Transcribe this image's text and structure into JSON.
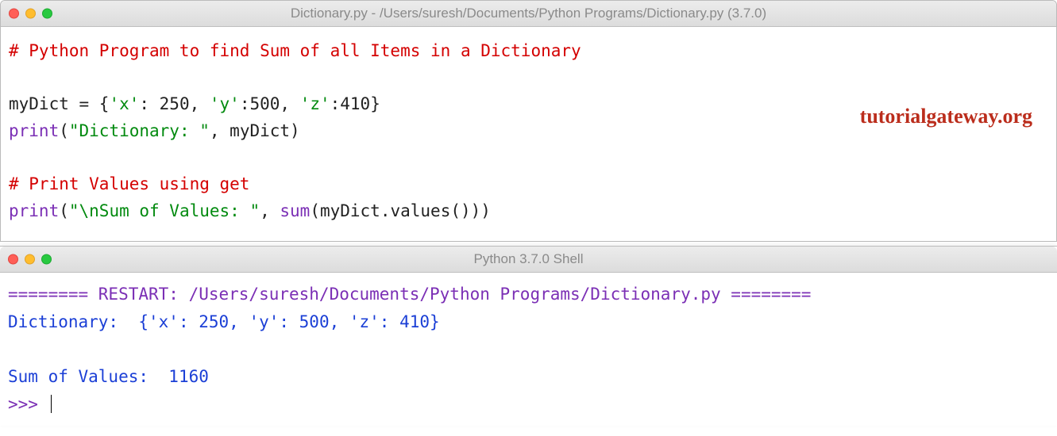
{
  "editor": {
    "title": "Dictionary.py - /Users/suresh/Documents/Python Programs/Dictionary.py (3.7.0)",
    "code": {
      "line1_comment": "# Python Program to find Sum of all Items in a Dictionary",
      "line3_var": "myDict = {",
      "line3_k1": "'x'",
      "line3_c1": ": 250, ",
      "line3_k2": "'y'",
      "line3_c2": ":500, ",
      "line3_k3": "'z'",
      "line3_c3": ":410}",
      "line4_print": "print",
      "line4_open": "(",
      "line4_str": "\"Dictionary: \"",
      "line4_rest": ", myDict)",
      "line6_comment": "# Print Values using get",
      "line7_print": "print",
      "line7_open": "(",
      "line7_str": "\"\\nSum of Values: \"",
      "line7_mid": ", ",
      "line7_sum": "sum",
      "line7_rest": "(myDict.values()))"
    },
    "watermark": "tutorialgateway.org"
  },
  "shell": {
    "title": "Python 3.7.0 Shell",
    "restart_prefix": "======== RESTART: /Users/suresh/Documents/Python Programs/Dictionary.py ========",
    "out_label": "Dictionary:  ",
    "out_value": "{'x': 250, 'y': 500, 'z': 410}",
    "sum_label": "Sum of Values:  ",
    "sum_value": "1160",
    "prompt": ">>> "
  }
}
